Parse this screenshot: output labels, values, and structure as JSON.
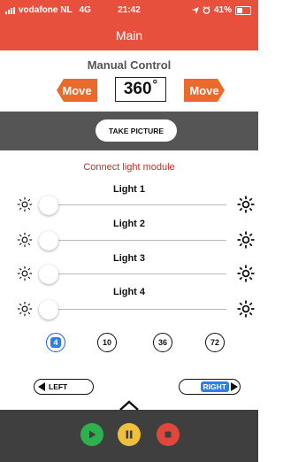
{
  "status_bar": {
    "carrier": "vodafone NL",
    "network": "4G",
    "time": "21:42",
    "battery": "41%",
    "battery_level": 0.41,
    "icons": [
      "signal-bars-icon",
      "location-arrow-icon",
      "alarm-icon",
      "battery-icon"
    ]
  },
  "header": {
    "title": "Main",
    "background": "#e8503e"
  },
  "manual_control": {
    "label": "Manual Control",
    "move_left_label": "Move",
    "move_right_label": "Move",
    "angle_value": "360",
    "degree_symbol": "°"
  },
  "camera": {
    "take_picture_label": "TAKE PICTURE"
  },
  "lights": {
    "connect_label": "Connect light module",
    "items": [
      {
        "label": "Light 1",
        "value": 0
      },
      {
        "label": "Light 2",
        "value": 0
      },
      {
        "label": "Light 3",
        "value": 0
      },
      {
        "label": "Light 4",
        "value": 0
      }
    ],
    "low_icon": "sun-small-icon",
    "high_icon": "sun-large-icon"
  },
  "step_options": {
    "options": [
      "4",
      "10",
      "36",
      "72"
    ],
    "selected": "4"
  },
  "direction": {
    "left_label": "LEFT",
    "right_label": "RIGHT",
    "selected": "RIGHT"
  },
  "playback": {
    "play_icon": "play-icon",
    "pause_icon": "pause-icon",
    "stop_icon": "stop-icon",
    "colors": {
      "play": "#2eb04f",
      "pause": "#f0c03a",
      "stop": "#e0473b"
    }
  }
}
